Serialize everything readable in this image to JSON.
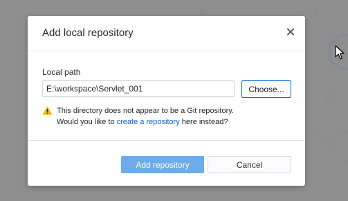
{
  "dialog": {
    "title": "Add local repository",
    "close_icon": "close-icon"
  },
  "form": {
    "path_label": "Local path",
    "path_value": "E:\\workspace\\Servlet_001",
    "choose_label": "Choose..."
  },
  "warning": {
    "icon": "warning-icon",
    "line1": "This directory does not appear to be a Git repository.",
    "line2_prefix": "Would you like to ",
    "link_text": "create a repository",
    "line2_suffix": " here instead?"
  },
  "footer": {
    "add_label": "Add repository",
    "cancel_label": "Cancel"
  },
  "colors": {
    "accent": "#0366d6",
    "primary_disabled": "#6eabeb",
    "warning": "#f0b400",
    "overlay": "#8e8e8e"
  }
}
